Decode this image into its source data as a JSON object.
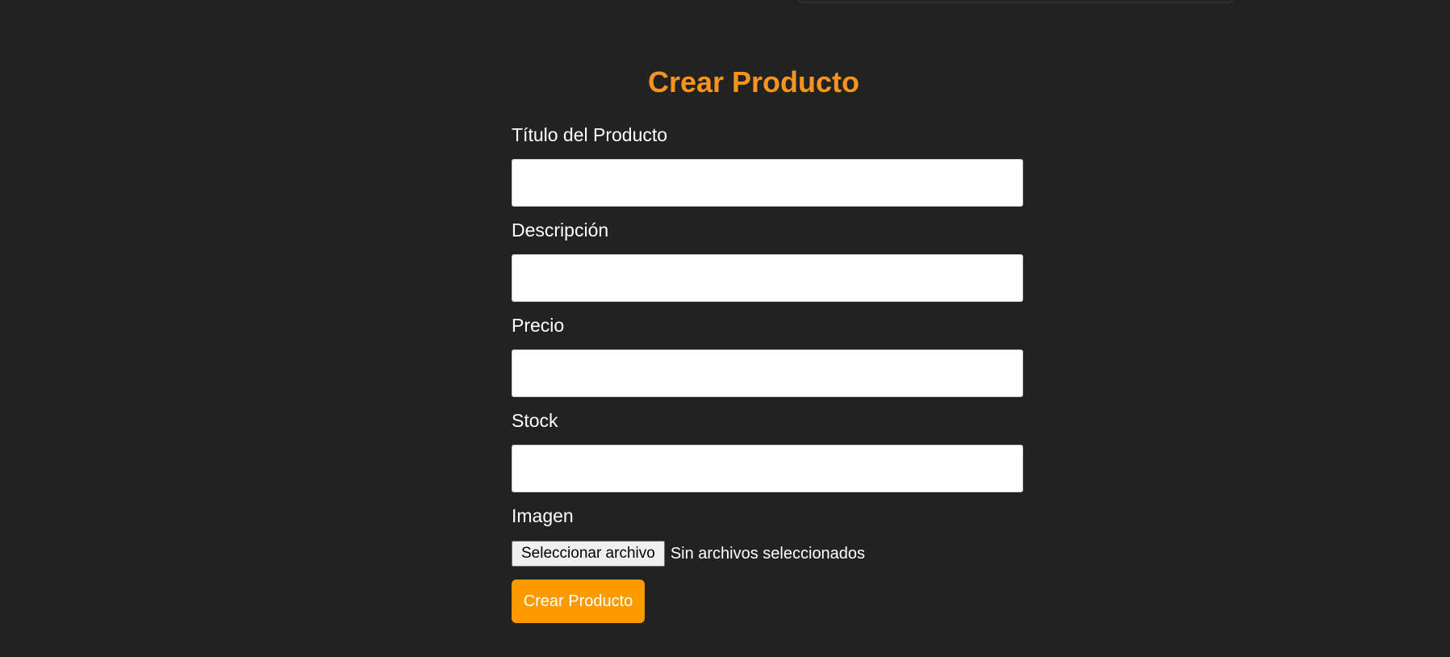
{
  "form": {
    "title": "Crear Producto",
    "fields": [
      {
        "label": "Título del Producto",
        "value": "",
        "placeholder": ""
      },
      {
        "label": "Descripción",
        "value": "",
        "placeholder": ""
      },
      {
        "label": "Precio",
        "value": "",
        "placeholder": ""
      },
      {
        "label": "Stock",
        "value": "",
        "placeholder": ""
      }
    ],
    "image": {
      "label": "Imagen",
      "button_label": "Seleccionar archivo",
      "status": "Sin archivos seleccionados"
    },
    "submit_label": "Crear Producto"
  },
  "colors": {
    "background": "#222222",
    "accent_title": "#f7941d",
    "accent_button": "#fd9a00",
    "label_text": "#ffffff"
  }
}
